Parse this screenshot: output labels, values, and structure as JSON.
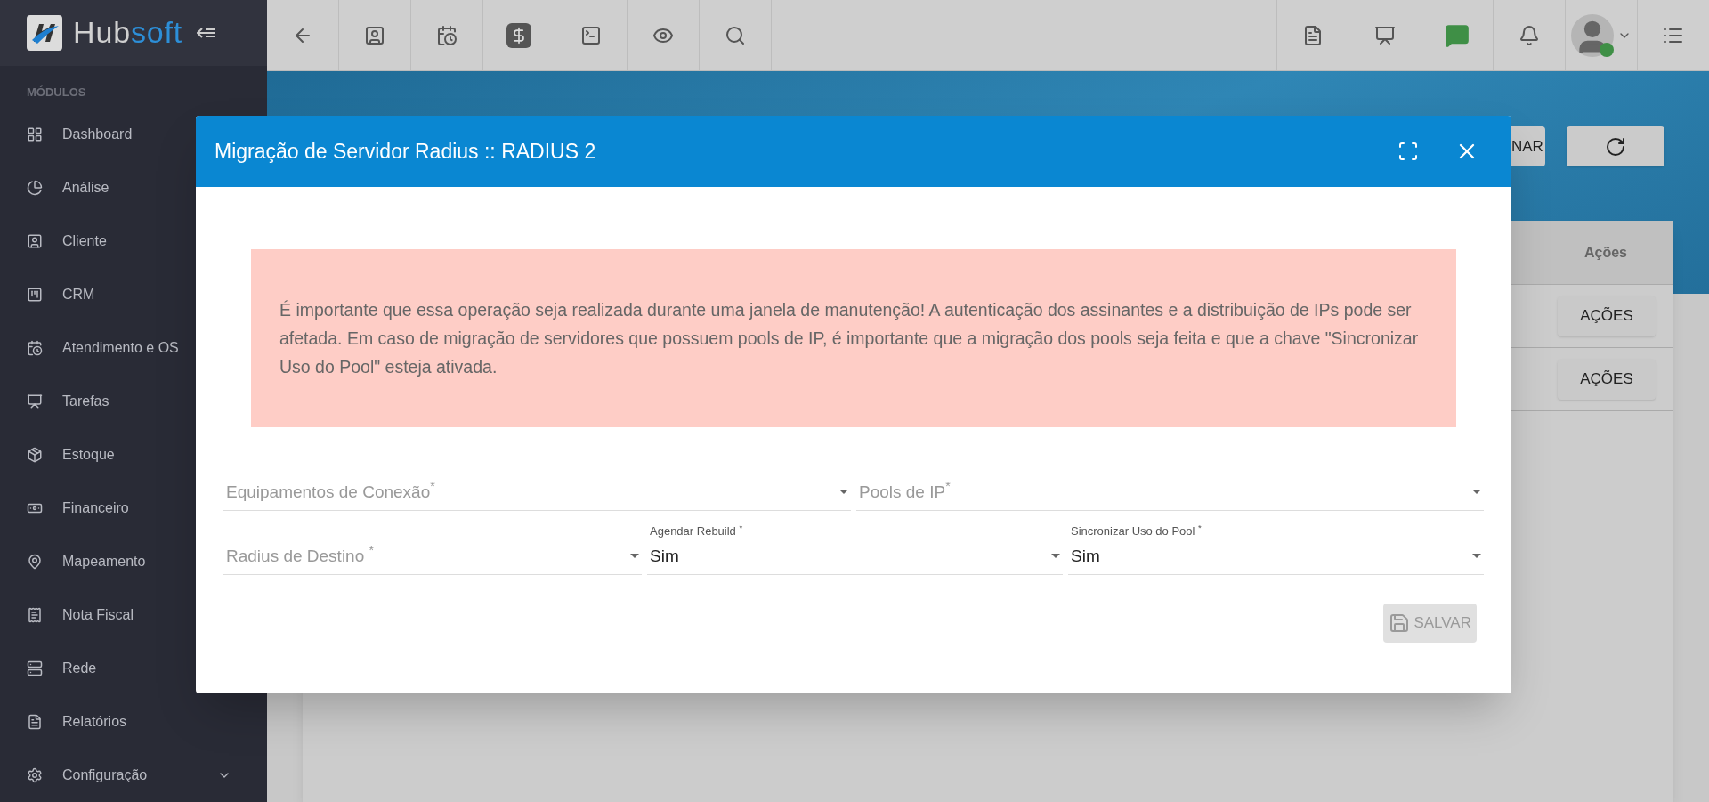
{
  "logo": {
    "first": "Hub",
    "second": "soft"
  },
  "sidebar": {
    "heading": "MÓDULOS",
    "items": [
      {
        "label": "Dashboard",
        "kind": "link"
      },
      {
        "label": "Análise",
        "kind": "link"
      },
      {
        "label": "Cliente",
        "kind": "link"
      },
      {
        "label": "CRM",
        "kind": "link"
      },
      {
        "label": "Atendimento e OS",
        "kind": "link"
      },
      {
        "label": "Tarefas",
        "kind": "link"
      },
      {
        "label": "Estoque",
        "kind": "link"
      },
      {
        "label": "Financeiro",
        "kind": "link"
      },
      {
        "label": "Mapeamento",
        "kind": "link"
      },
      {
        "label": "Nota Fiscal",
        "kind": "link"
      },
      {
        "label": "Rede",
        "kind": "link"
      },
      {
        "label": "Relatórios",
        "kind": "link"
      },
      {
        "label": "Configuração",
        "kind": "group"
      }
    ]
  },
  "page": {
    "partial_button": "NAR",
    "table_header": "Ações",
    "row_buttons": [
      "AÇÕES",
      "AÇÕES"
    ]
  },
  "modal": {
    "title": "Migração de Servidor Radius :: RADIUS 2",
    "alert": "É importante que essa operação seja realizada durante uma janela de manutenção! A autenticação dos assinantes e a distribuição de IPs pode ser afetada. Em caso de migração de servidores que possuem pools de IP, é importante que a migração dos pools seja feita e que a chave \"Sincronizar Uso do Pool\" esteja ativada.",
    "rows": [
      [
        {
          "label": "Equipamentos de Conexão$^{*}$"
        },
        {
          "label": "Pools de IP$^{*}$"
        }
      ],
      [
        {
          "label": "Radius de Destino $^{*}$"
        },
        {
          "label": "Agendar Rebuild $^{*}$",
          "value": "Sim"
        },
        {
          "label": "Sincronizar Uso do Pool $^{*}$",
          "value": "Sim"
        }
      ]
    ],
    "save": {
      "label": "SALVAR",
      "disabled": true
    }
  }
}
